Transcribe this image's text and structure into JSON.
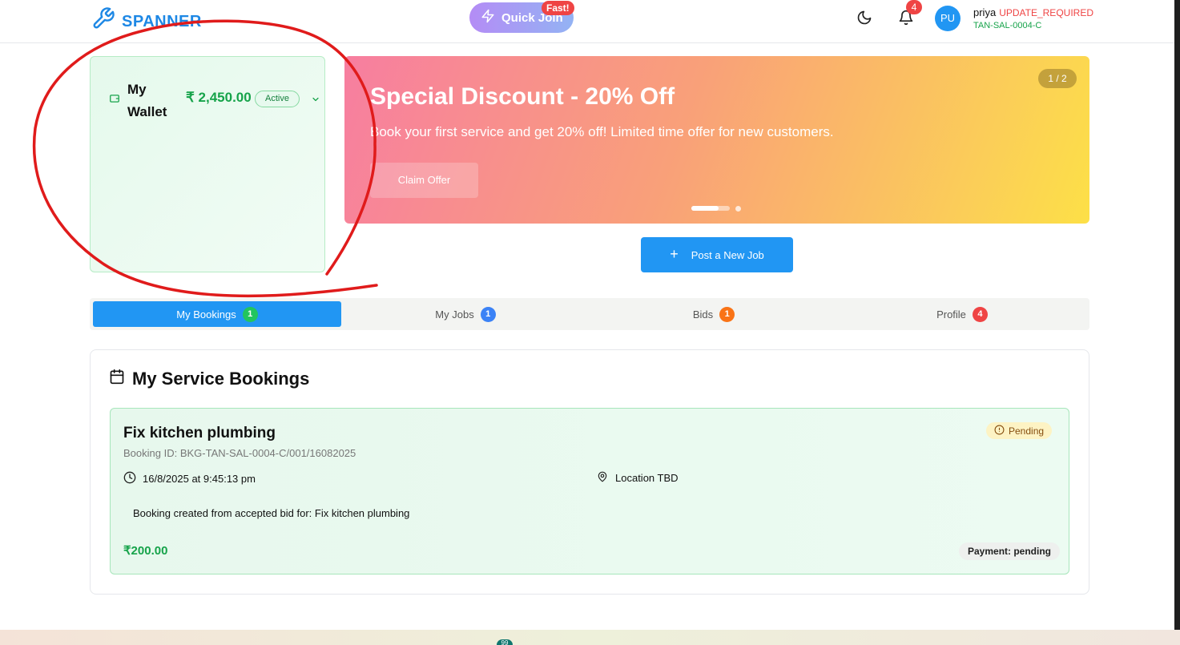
{
  "header": {
    "logo_text": "SPANNER",
    "quick_join_label": "Quick Join",
    "fast_badge": "Fast!",
    "notification_count": "4",
    "avatar_initials": "PU",
    "user_name": "priya",
    "user_status": "UPDATE_REQUIRED",
    "user_code": "TAN-SAL-0004-C"
  },
  "wallet": {
    "title": "My Wallet",
    "amount": "₹ 2,450.00",
    "status": "Active"
  },
  "banner": {
    "title": "Special Discount - 20% Off",
    "text": "Book your first service and get 20% off! Limited time offer for new customers.",
    "button_label": "Claim Offer",
    "counter": "1 / 2"
  },
  "post_job_label": "Post a New Job",
  "tabs": [
    {
      "label": "My Bookings",
      "count": "1",
      "color": "#22c55e"
    },
    {
      "label": "My Jobs",
      "count": "1",
      "color": "#3b82f6"
    },
    {
      "label": "Bids",
      "count": "1",
      "color": "#f97316"
    },
    {
      "label": "Profile",
      "count": "4",
      "color": "#ef4444"
    }
  ],
  "bookings": {
    "section_title": "My Service Bookings",
    "item": {
      "title": "Fix kitchen plumbing",
      "booking_id": "Booking ID: BKG-TAN-SAL-0004-C/001/16082025",
      "datetime": "16/8/2025 at 9:45:13 pm",
      "location": "Location TBD",
      "description": "Booking created from accepted bid for: Fix kitchen plumbing",
      "price": "₹200.00",
      "status": "Pending",
      "payment": "Payment: pending"
    }
  },
  "taskbar_badge": "99",
  "colors": {
    "primary": "#2196f3",
    "success": "#16a34a",
    "danger": "#ef4444",
    "annotation": "#e01b1b"
  }
}
